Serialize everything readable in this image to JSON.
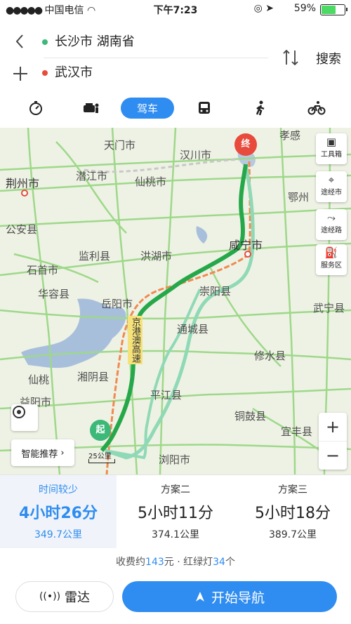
{
  "status_bar": {
    "carrier": "中国电信",
    "time": "下午7:23",
    "battery_percent": "59%",
    "battery_level": 0.59
  },
  "route": {
    "origin": "长沙市 湖南省",
    "destination": "武汉市",
    "search_label": "搜索",
    "origin_color": "#3cb878",
    "destination_color": "#e84a3c"
  },
  "modes": {
    "active_label": "驾车",
    "items": [
      "timer-icon",
      "taxi-icon",
      "drive",
      "bus-icon",
      "walk-icon",
      "bike-icon"
    ]
  },
  "map": {
    "labels": {
      "jingzhou": "荆州市",
      "tianmen": "天门市",
      "hanchuan": "汉川市",
      "qianjiang": "潜江市",
      "xiantao": "仙桃市",
      "xiaogan_cut": "孝感",
      "gongan": "公安县",
      "jianli": "监利县",
      "honghu": "洪湖市",
      "xianning": "咸宁市",
      "shishou": "石首市",
      "huarong": "华容县",
      "yueyang": "岳阳市",
      "chongyang": "崇阳县",
      "tongcheng": "通城县",
      "wuning": "武宁县",
      "xiushui": "修水县",
      "pingjiang": "平江县",
      "xiangyin": "湘阴县",
      "yiyang": "益阳市",
      "tonggu": "铜鼓县",
      "yifeng": "宜丰县",
      "liuyang": "浏阳市",
      "ezhou": "鄂州",
      "xiantao2": "仙桃",
      "highway": "京港澳高速"
    },
    "start_pin": "起",
    "end_pin": "终",
    "scale_label": "25公里",
    "tools": [
      {
        "label": "工具箱",
        "icon": "toolbox-icon"
      },
      {
        "label": "途经市",
        "icon": "location-icon"
      },
      {
        "label": "途经路",
        "icon": "route-icon"
      },
      {
        "label": "服务区",
        "icon": "service-area-icon"
      }
    ],
    "smart_label": "智能推荐",
    "zoom_in": "+",
    "zoom_out": "−",
    "route_color": "#26a84a",
    "alt_route_color": "#8fd9b6"
  },
  "plans": [
    {
      "label": "时间较少",
      "duration": "4小时26分",
      "distance": "349.7公里",
      "active": true
    },
    {
      "label": "方案二",
      "duration": "5小时11分",
      "distance": "374.1公里",
      "active": false
    },
    {
      "label": "方案三",
      "duration": "5小时18分",
      "distance": "389.7公里",
      "active": false
    }
  ],
  "fee": {
    "prefix": "收费约",
    "amount": "143",
    "unit": "元 · 红绿灯",
    "lights": "34",
    "suffix": "个"
  },
  "bottom": {
    "radar_label": "雷达",
    "start_nav_label": "开始导航",
    "accent": "#2f8cf0"
  }
}
